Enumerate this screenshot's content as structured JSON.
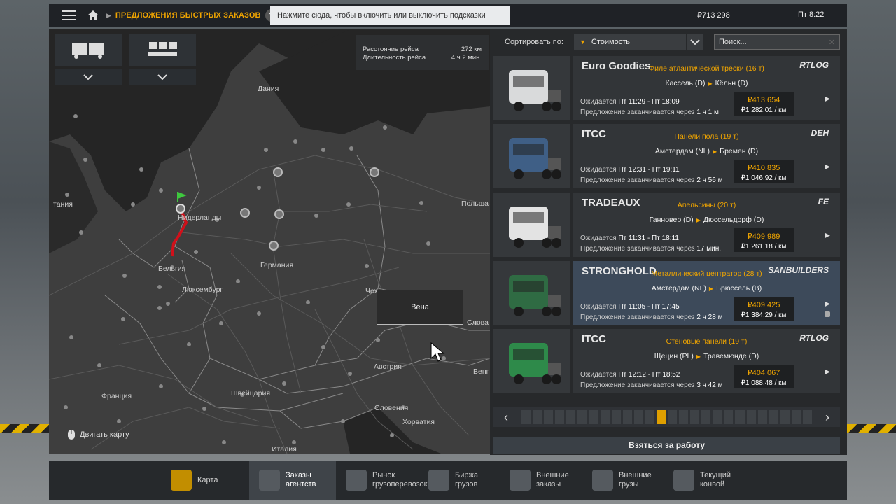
{
  "topbar": {
    "breadcrumb": "ПРЕДЛОЖЕНИЯ БЫСТРЫХ ЗАКАЗОВ",
    "help": "?",
    "hint": "Нажмите сюда, чтобы включить или выключить подсказки",
    "money": "₽713 298",
    "time": "Пт 8:22"
  },
  "map": {
    "route_info": {
      "distance_label": "Расстояние рейса",
      "distance_value": "272 км",
      "duration_label": "Длительность рейса",
      "duration_value": "4 ч 2 мин."
    },
    "labels": {
      "denmark": "Дания",
      "britain": "тания",
      "netherlands": "Нидерланды",
      "belgium": "Бельгия",
      "luxembourg": "Люксембург",
      "germany": "Германия",
      "poland": "Польша",
      "czech": "Чех",
      "slovakia": "Слова",
      "austria": "Австрия",
      "hungary": "Венг",
      "switzerland": "Швейцария",
      "france": "Франция",
      "slovenia": "Словения",
      "croatia": "Хорватия",
      "italy": "Италия"
    },
    "tooltip": "Вена",
    "move_map": "Двигать карту"
  },
  "sort": {
    "label": "Сортировать по:",
    "value": "Стоимость",
    "search_placeholder": "Поиск..."
  },
  "jobs": [
    {
      "company": "Euro Goodies",
      "cargo": "Филе атлантической трески (16 т)",
      "from": "Кассель (D)",
      "to": "Кёльн (D)",
      "expected_label": "Ожидается",
      "expected": "Пт 11:29 - Пт 18:09",
      "expires_label": "Предложение заканчивается через",
      "expires": "1 ч 1 м",
      "price": "₽413 654",
      "rate": "₽1 282,01 / км",
      "logo_right": "RTLOG",
      "truck_color": "#d9dadb",
      "selected": false
    },
    {
      "company": "ITCC",
      "cargo": "Панели пола (19 т)",
      "from": "Амстердам (NL)",
      "to": "Бремен (D)",
      "expected_label": "Ожидается",
      "expected": "Пт 12:31 - Пт 19:11",
      "expires_label": "Предложение заканчивается через",
      "expires": "2 ч 56 м",
      "price": "₽410 835",
      "rate": "₽1 046,92 / км",
      "logo_right": "DEH",
      "truck_color": "#3f5f86",
      "selected": false
    },
    {
      "company": "TRADEAUX",
      "cargo": "Апельсины (20 т)",
      "from": "Ганновер (D)",
      "to": "Дюссельдорф (D)",
      "expected_label": "Ожидается",
      "expected": "Пт 11:31 - Пт 18:11",
      "expires_label": "Предложение заканчивается через",
      "expires": "17 мин.",
      "price": "₽409 989",
      "rate": "₽1 261,18 / км",
      "logo_right": "FE",
      "truck_color": "#e3e3e3",
      "selected": false
    },
    {
      "company": "STRONGHOLD",
      "cargo": "Металлический центратор (28 т)",
      "from": "Амстердам (NL)",
      "to": "Брюссель (B)",
      "expected_label": "Ожидается",
      "expected": "Пт 11:05 - Пт 17:45",
      "expires_label": "Предложение заканчивается через",
      "expires": "2 ч 28 м",
      "price": "₽409 425",
      "rate": "₽1 384,29 / км",
      "logo_right": "SANBUILDERS",
      "truck_color": "#2f6b43",
      "selected": true
    },
    {
      "company": "ITCC",
      "cargo": "Стеновые панели (19 т)",
      "from": "Щецин (PL)",
      "to": "Травемюнде (D)",
      "expected_label": "Ожидается",
      "expected": "Пт 12:12 - Пт 18:52",
      "expires_label": "Предложение заканчивается через",
      "expires": "3 ч 42 м",
      "price": "₽404 067",
      "rate": "₽1 088,48 / км",
      "logo_right": "RTLOG",
      "truck_color": "#2e8a4a",
      "selected": false
    }
  ],
  "pager": {
    "total": 26,
    "current": 12
  },
  "take_job": "Взяться за работу",
  "tabs": [
    {
      "label": "Карта",
      "icon": "map-icon"
    },
    {
      "label": "Заказы агентств",
      "icon": "clock-icon"
    },
    {
      "label": "Рынок грузоперевозок",
      "icon": "market-icon"
    },
    {
      "label": "Биржа грузов",
      "icon": "freight-icon"
    },
    {
      "label": "Внешние заказы",
      "icon": "globe-icon"
    },
    {
      "label": "Внешние грузы",
      "icon": "globe-cargo-icon"
    },
    {
      "label": "Текущий конвой",
      "icon": "convoy-icon"
    }
  ],
  "active_tab": 1
}
